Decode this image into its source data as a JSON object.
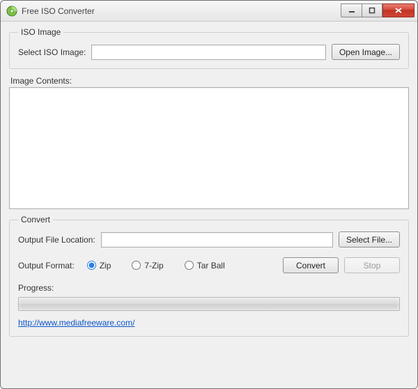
{
  "window": {
    "title": "Free ISO Converter"
  },
  "iso": {
    "legend": "ISO Image",
    "select_label": "Select ISO Image:",
    "path_value": "",
    "open_button": "Open Image..."
  },
  "contents": {
    "label": "Image Contents:"
  },
  "convert": {
    "legend": "Convert",
    "output_label": "Output File Location:",
    "output_value": "",
    "select_file_button": "Select File...",
    "format_label": "Output Format:",
    "formats": {
      "zip": "Zip",
      "sevenzip": "7-Zip",
      "tarball": "Tar Ball"
    },
    "selected_format": "zip",
    "convert_button": "Convert",
    "stop_button": "Stop",
    "progress_label": "Progress:",
    "progress_percent": 0
  },
  "link": {
    "text": "http://www.mediafreeware.com/"
  }
}
